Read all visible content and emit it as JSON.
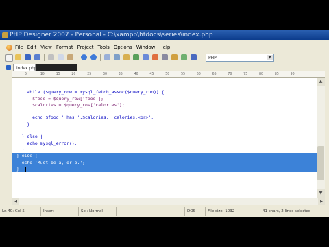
{
  "titlebar": {
    "title": "PHP Designer 2007 - Personal - C:\\xampp\\htdocs\\series\\index.php"
  },
  "menu": [
    "File",
    "Edit",
    "View",
    "Format",
    "Project",
    "Tools",
    "Options",
    "Window",
    "Help"
  ],
  "toolbar": {
    "language_select": "PHP"
  },
  "tabs": [
    {
      "label": "index.php",
      "active": true
    },
    {
      "label": "",
      "active": false
    }
  ],
  "ruler": {
    "ticks": [
      "5",
      "10",
      "15",
      "20",
      "25",
      "30",
      "35",
      "40",
      "45",
      "50",
      "55",
      "60",
      "65",
      "70",
      "75",
      "80",
      "85",
      "90"
    ]
  },
  "code": {
    "lines": [
      "",
      "    while ($query_row = mysql_fetch_assoc($query_run)) {",
      "      $food = $query_row['food'];",
      "      $calories = $query_row['calories'];",
      "",
      "      echo $food.' has '.$calories.' calories.<br>';",
      "    }",
      "",
      "  } else {",
      "    echo mysql_error();",
      "  }",
      "} else {",
      "  echo 'Must be a, or b.';",
      "}"
    ],
    "selected_lines": [
      11,
      12,
      13
    ]
  },
  "status": {
    "position": "Ln 40: Col 5",
    "mode": "Insert",
    "selection_mode": "Sel: Normal",
    "line_ending": "DOS",
    "file_size": "File size: 1032",
    "selection_info": "41 chars, 2 lines selected"
  },
  "colors": {
    "selection": "#3c82d8",
    "keyword": "#0000c0",
    "variable": "#7a1e6e"
  }
}
